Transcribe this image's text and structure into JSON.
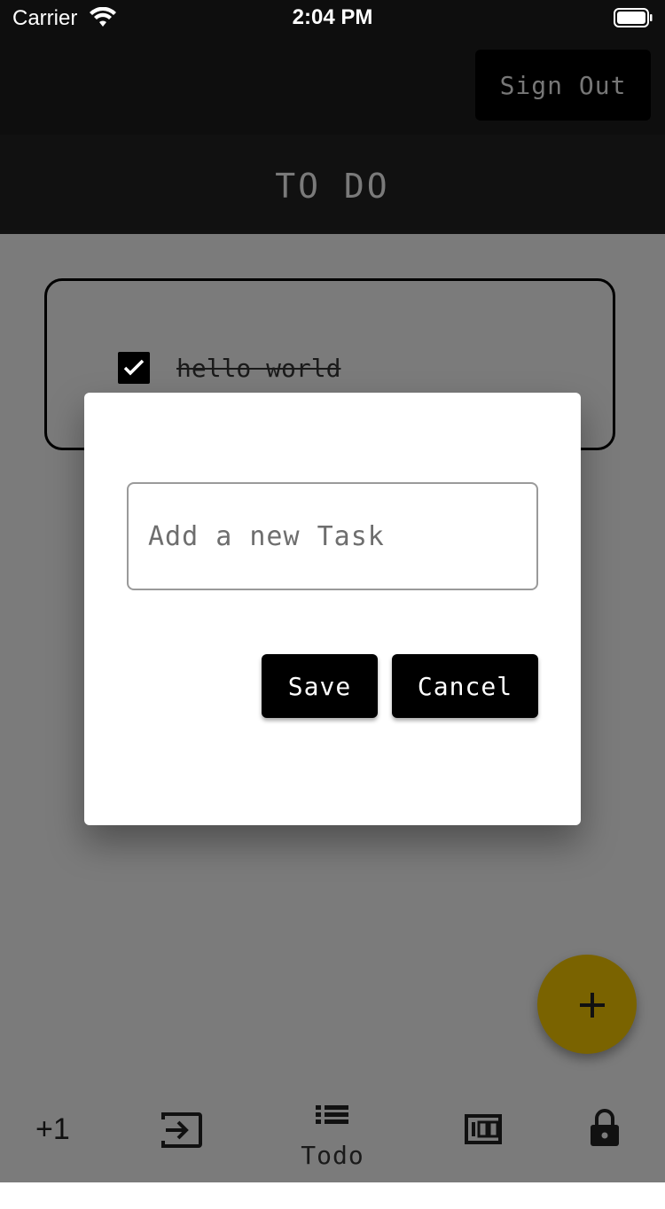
{
  "status_bar": {
    "carrier": "Carrier",
    "time": "2:04 PM",
    "wifi_icon": "wifi-icon",
    "battery_icon": "battery-icon"
  },
  "header": {
    "sign_out_label": "Sign Out",
    "title": "TO DO"
  },
  "tasks": [
    {
      "text": "hello world",
      "completed": true
    }
  ],
  "dialog": {
    "input_placeholder": "Add a new Task",
    "input_value": "",
    "save_label": "Save",
    "cancel_label": "Cancel"
  },
  "fab": {
    "icon": "plus-icon",
    "color": "#7a6300"
  },
  "bottom_nav": {
    "items": [
      {
        "icon": "plus-one-icon",
        "text": "+1"
      },
      {
        "icon": "input-icon"
      },
      {
        "icon": "list-icon",
        "label": "Todo",
        "active": true
      },
      {
        "icon": "counter-icon"
      },
      {
        "icon": "lock-icon"
      }
    ]
  },
  "colors": {
    "appbar": "#0e0e0e",
    "scrim_background": "#7b7b7b",
    "button": "#000000",
    "dialog": "#ffffff"
  }
}
